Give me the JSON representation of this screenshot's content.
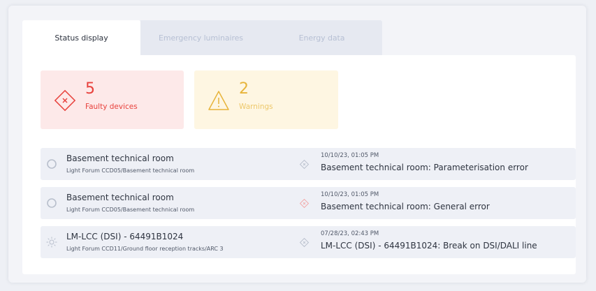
{
  "tabs": [
    {
      "label": "Status display",
      "active": true
    },
    {
      "label": "Emergency luminaires",
      "active": false
    },
    {
      "label": "Energy data",
      "active": false
    }
  ],
  "summary": {
    "faulty": {
      "count": "5",
      "label": "Faulty devices",
      "icon": "error-diamond-icon",
      "color": "#e8413c"
    },
    "warnings": {
      "count": "2",
      "label": "Warnings",
      "icon": "warning-triangle-icon",
      "color": "#e7b43a"
    }
  },
  "events": [
    {
      "device_icon": "circle-device-icon",
      "device_name": "Basement technical room",
      "device_path": "Light Forum CCD05/Basement technical room",
      "event_icon": "error-diamond-icon",
      "event_time": "10/10/23, 01:05 PM",
      "event_message": "Basement technical room: Parameterisation error"
    },
    {
      "device_icon": "circle-device-icon",
      "device_name": "Basement technical room",
      "device_path": "Light Forum CCD05/Basement technical room",
      "event_icon": "error-diamond-icon",
      "event_time": "10/10/23, 01:05 PM",
      "event_message": "Basement technical room: General error"
    },
    {
      "device_icon": "luminaire-sun-icon",
      "device_name": "LM-LCC (DSI) - 64491B1024",
      "device_path": "Light Forum CCD11/Ground floor reception tracks/ARC 3",
      "event_icon": "error-diamond-icon",
      "event_time": "07/28/23, 02:43 PM",
      "event_message": "LM-LCC (DSI) - 64491B1024: Break on DSI/DALI line"
    }
  ]
}
